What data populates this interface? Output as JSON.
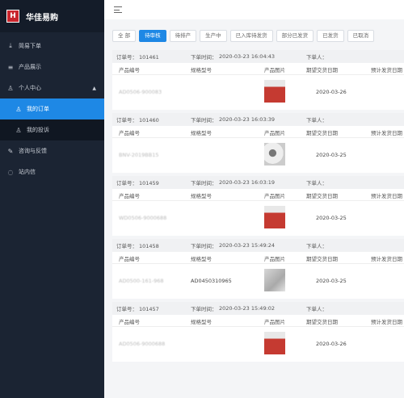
{
  "brand": {
    "logo_text": "H",
    "name": "华佳易购"
  },
  "sidebar": {
    "items": [
      {
        "label": "简易下单",
        "icon": "download-icon"
      },
      {
        "label": "产品展示",
        "icon": "menu-icon"
      },
      {
        "label": "个人中心",
        "icon": "user-icon"
      },
      {
        "label": "我的订单",
        "icon": "user-icon"
      },
      {
        "label": "我的投诉",
        "icon": "user-icon"
      },
      {
        "label": "咨询与反馈",
        "icon": "edit-icon"
      },
      {
        "label": "站内信",
        "icon": "message-icon"
      }
    ]
  },
  "tabs": [
    "全 部",
    "待审核",
    "待排产",
    "生产中",
    "已入库待发货",
    "部分已发货",
    "已发货",
    "已取消"
  ],
  "labels": {
    "order_no": "订单号：",
    "order_time": "下单时间：",
    "orderer": "下单人：",
    "col_code": "产品编号",
    "col_spec": "规格型号",
    "col_image": "产品图片",
    "col_delivery": "期望交货日期",
    "col_ship": "预计发货日期"
  },
  "orders": [
    {
      "no": "101461",
      "time": "2020-03-23 16:04:43",
      "code": "AD0506-900083",
      "spec": "",
      "delivery": "2020-03-26",
      "thumb": "red"
    },
    {
      "no": "101460",
      "time": "2020-03-23 16:03:39",
      "code": "BNV-2019BB15",
      "spec": "",
      "delivery": "2020-03-25",
      "thumb": "photo"
    },
    {
      "no": "101459",
      "time": "2020-03-23 16:03:19",
      "code": "WD0506-9000688",
      "spec": "",
      "delivery": "2020-03-25",
      "thumb": "red"
    },
    {
      "no": "101458",
      "time": "2020-03-23 15:49:24",
      "code": "AD0500-161-968",
      "spec": "AD0450310965",
      "delivery": "2020-03-25",
      "thumb": "gray"
    },
    {
      "no": "101457",
      "time": "2020-03-23 15:49:02",
      "code": "AD0506-9000688",
      "spec": "",
      "delivery": "2020-03-26",
      "thumb": "red"
    }
  ]
}
